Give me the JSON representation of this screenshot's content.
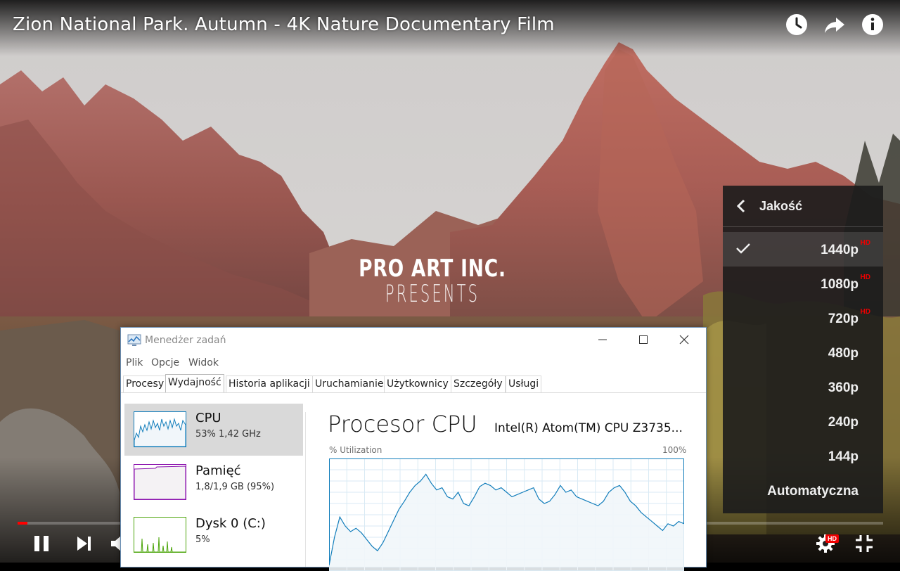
{
  "video": {
    "title": "Zion National Park. Autumn - 4K Nature Documentary Film",
    "watermark_line1": "PRO ART INC.",
    "watermark_line2": "PRESENTS",
    "top_icons": [
      "watch-later-icon",
      "share-icon",
      "info-icon"
    ],
    "progress_percent": 1.1,
    "progress_color": "#ff0000",
    "settings_badge": "HD"
  },
  "quality_menu": {
    "title": "Jakość",
    "selected": "1440p",
    "options": [
      {
        "label": "1440p",
        "badge": "HD"
      },
      {
        "label": "1080p",
        "badge": "HD"
      },
      {
        "label": "720p",
        "badge": "HD"
      },
      {
        "label": "480p",
        "badge": ""
      },
      {
        "label": "360p",
        "badge": ""
      },
      {
        "label": "240p",
        "badge": ""
      },
      {
        "label": "144p",
        "badge": ""
      },
      {
        "label": "Automatyczna",
        "badge": ""
      }
    ]
  },
  "task_manager": {
    "window_title": "Menedżer zadań",
    "menu": [
      "Plik",
      "Opcje",
      "Widok"
    ],
    "tabs": [
      "Procesy",
      "Wydajność",
      "Historia aplikacji",
      "Uruchamianie",
      "Użytkownicy",
      "Szczegóły",
      "Usługi"
    ],
    "active_tab": "Wydajność",
    "resources": [
      {
        "name": "CPU",
        "detail": "53%  1,42 GHz",
        "color": "#117dbb"
      },
      {
        "name": "Pamięć",
        "detail": "1,8/1,9 GB (95%)",
        "color": "#8b12ae"
      },
      {
        "name": "Dysk 0 (C:)",
        "detail": "5%",
        "color": "#4da60c"
      }
    ],
    "panel_title": "Procesor CPU",
    "cpu_model": "Intel(R) Atom(TM) CPU Z3735...",
    "util_label": "% Utilization",
    "util_max": "100%",
    "cpu_history": [
      5,
      30,
      48,
      40,
      35,
      38,
      34,
      28,
      22,
      18,
      25,
      35,
      45,
      55,
      62,
      70,
      76,
      80,
      86,
      78,
      72,
      74,
      66,
      64,
      70,
      60,
      58,
      66,
      75,
      78,
      76,
      72,
      74,
      70,
      66,
      68,
      70,
      72,
      74,
      64,
      60,
      62,
      68,
      76,
      70,
      72,
      66,
      64,
      62,
      60,
      58,
      62,
      70,
      74,
      76,
      70,
      62,
      58,
      52,
      48,
      44,
      40,
      36,
      42,
      40,
      44,
      42
    ]
  }
}
